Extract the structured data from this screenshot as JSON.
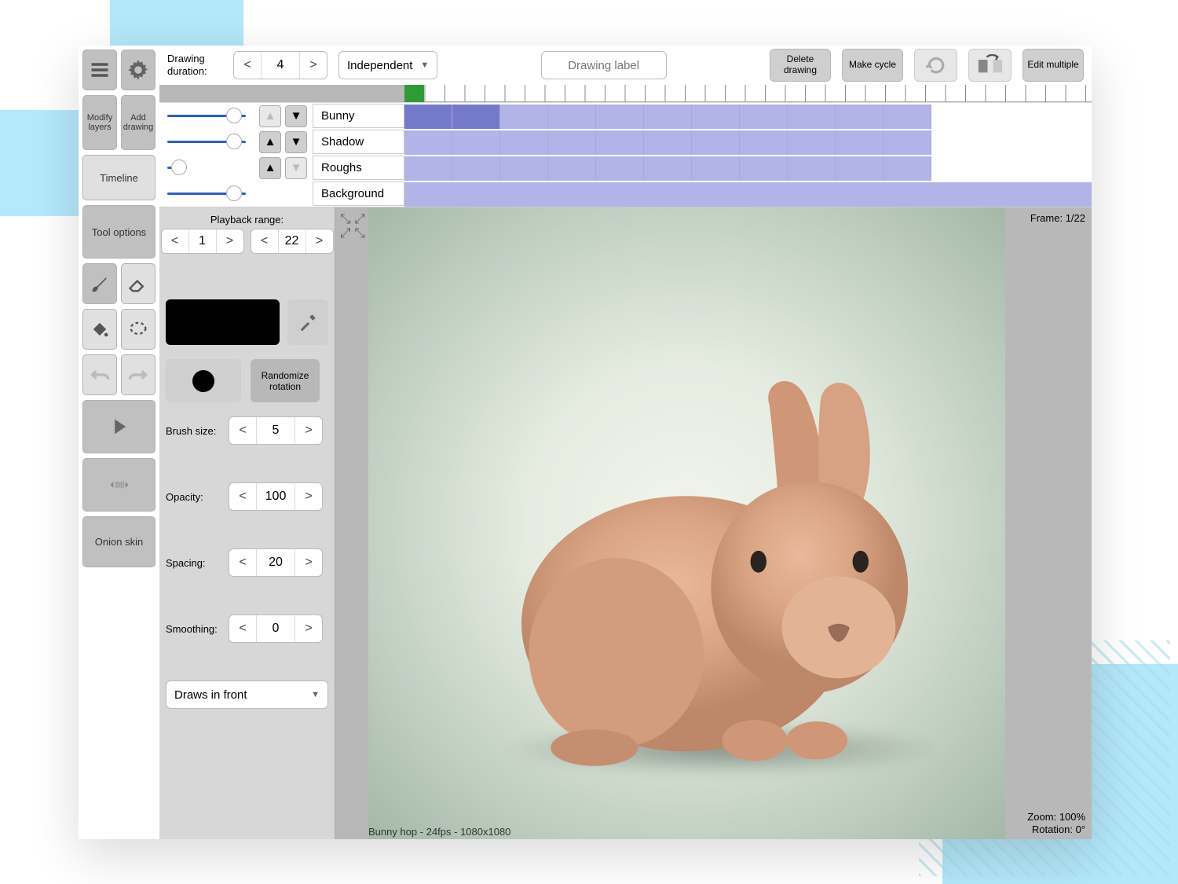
{
  "toolbar_left": {
    "menu": "≡",
    "settings": "⚙",
    "modify_layers": "Modify layers",
    "add_drawing": "Add drawing",
    "timeline": "Timeline",
    "tool_options": "Tool options",
    "onion_skin": "Onion skin"
  },
  "top": {
    "drawing_duration_label": "Drawing duration:",
    "drawing_duration": "4",
    "mode": "Independent",
    "drawing_label_placeholder": "Drawing label",
    "delete_drawing": "Delete drawing",
    "make_cycle": "Make cycle",
    "edit_multiple": "Edit multiple"
  },
  "layers": {
    "names": {
      "0": "Bunny",
      "1": "Shadow",
      "2": "Roughs",
      "3": "Background"
    }
  },
  "playback": {
    "label": "Playback range:",
    "start": "1",
    "end": "22"
  },
  "tool_options": {
    "randomize": "Randomize rotation",
    "brush_size_label": "Brush size:",
    "brush_size": "5",
    "opacity_label": "Opacity:",
    "opacity": "100",
    "spacing_label": "Spacing:",
    "spacing": "20",
    "smoothing_label": "Smoothing:",
    "smoothing": "0",
    "draws_in_front": "Draws in front"
  },
  "canvas": {
    "frame_indicator": "Frame: 1/22",
    "status": "Bunny hop - 24fps - 1080x1080",
    "zoom": "Zoom: 100%",
    "rotation": "Rotation: 0°"
  }
}
